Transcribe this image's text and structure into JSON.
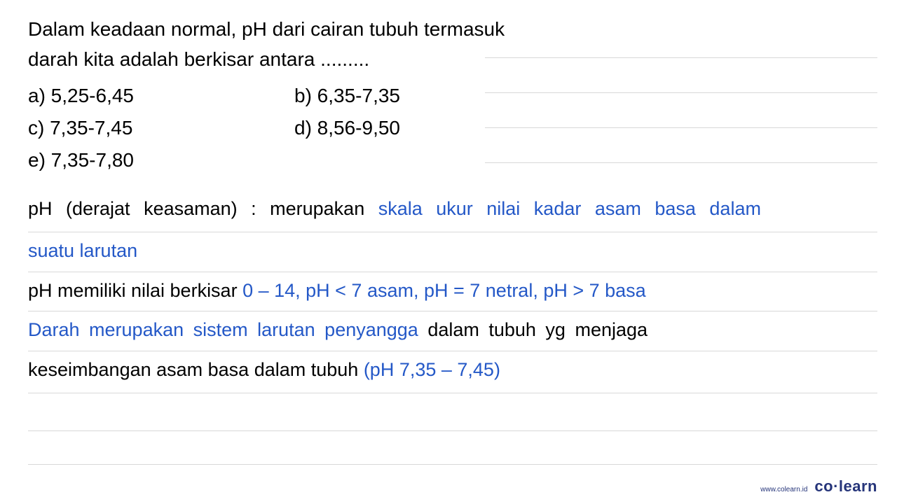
{
  "question": {
    "line1": "Dalam keadaan normal, pH dari cairan tubuh termasuk",
    "line2": "darah kita adalah berkisar antara ........."
  },
  "options": {
    "a": "a)  5,25-6,45",
    "b": "b)  6,35-7,35",
    "c": "c)  7,35-7,45",
    "d": "d)  8,56-9,50",
    "e": "e)  7,35-7,80"
  },
  "explanation": {
    "line1_black": "pH (derajat keasaman) : merupakan ",
    "line1_blue": "skala ukur  nilai  kadar asam  basa  dalam",
    "line2_blue": "suatu larutan",
    "line3_black": "pH memiliki nilai berkisar ",
    "line3_blue": "0 – 14, pH < 7 asam, pH = 7 netral, pH > 7 basa",
    "line4_blue": "Darah  merupakan  sistem  larutan  penyangga",
    "line4_black": "  dalam  tubuh  yg  menjaga",
    "line5_black": "keseimbangan asam basa dalam tubuh ",
    "line5_blue": "(pH 7,35 – 7,45)"
  },
  "footer": {
    "url": "www.colearn.id",
    "brand_co": "co",
    "brand_dot": "·",
    "brand_learn": "learn"
  }
}
